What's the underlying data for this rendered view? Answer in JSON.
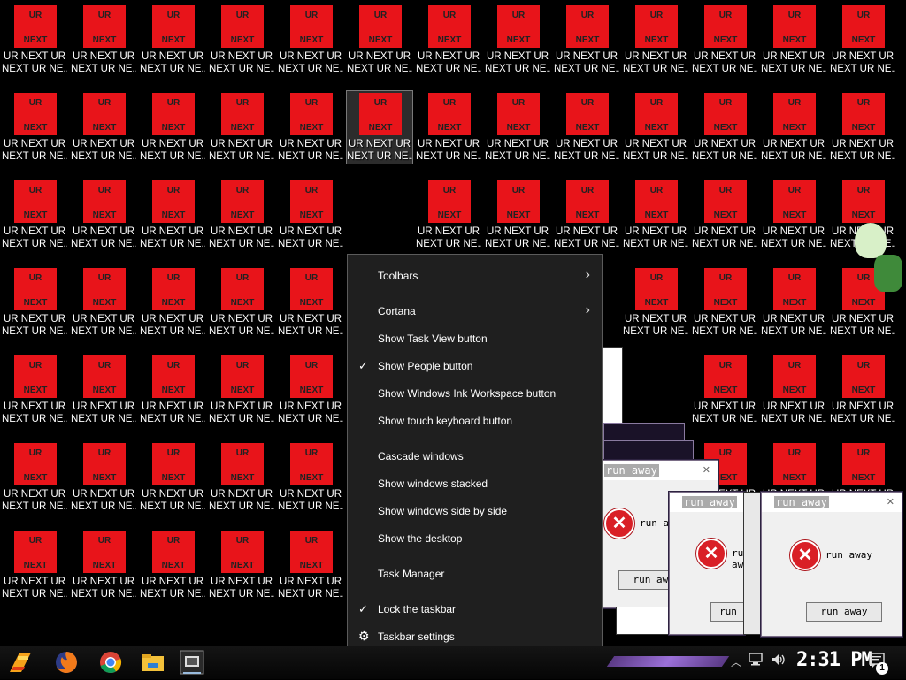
{
  "desktop": {
    "icon_image_top": "UR",
    "icon_image_bottom": "NEXT",
    "icon_label_line1": "UR NEXT UR",
    "icon_label_line2": "NEXT UR NE...",
    "icon_color": "#e8141a",
    "selected_icon": {
      "row": 2,
      "col": 6
    }
  },
  "error_dialog": {
    "title": "run away",
    "message": "run away",
    "button_label": "run away"
  },
  "context_menu": {
    "items": [
      {
        "label": "Toolbars",
        "submenu": true,
        "checked": false
      },
      {
        "label": "Cortana",
        "submenu": true,
        "checked": false
      },
      {
        "label": "Show Task View button",
        "submenu": false,
        "checked": false
      },
      {
        "label": "Show People button",
        "submenu": false,
        "checked": true
      },
      {
        "label": "Show Windows Ink Workspace button",
        "submenu": false,
        "checked": false
      },
      {
        "label": "Show touch keyboard button",
        "submenu": false,
        "checked": false
      },
      {
        "label": "Cascade windows",
        "submenu": false,
        "checked": false
      },
      {
        "label": "Show windows stacked",
        "submenu": false,
        "checked": false
      },
      {
        "label": "Show windows side by side",
        "submenu": false,
        "checked": false
      },
      {
        "label": "Show the desktop",
        "submenu": false,
        "checked": false
      },
      {
        "label": "Task Manager",
        "submenu": false,
        "checked": false
      },
      {
        "label": "Lock the taskbar",
        "submenu": false,
        "checked": true
      },
      {
        "label": "Taskbar settings",
        "submenu": false,
        "checked": false,
        "icon": "gear-icon"
      }
    ]
  },
  "taskbar": {
    "icons": [
      "start-icon",
      "firefox-icon",
      "chrome-icon",
      "file-explorer-icon",
      "app-icon"
    ],
    "clock": "2:31 PM",
    "notification_count": "1",
    "accent_color": "#7b4fc4"
  }
}
